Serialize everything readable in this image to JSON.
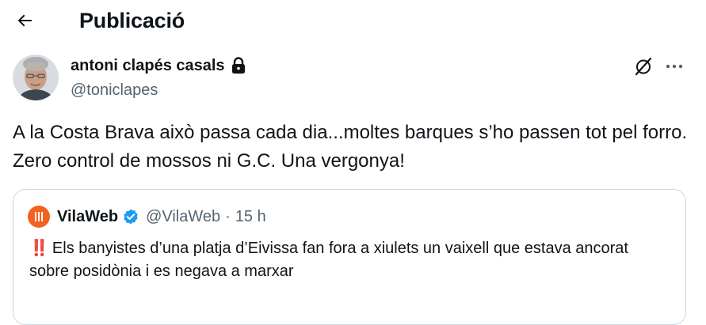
{
  "header": {
    "title": "Publicació",
    "back_icon": "arrow-left-icon"
  },
  "tweet": {
    "author_name": "antoni clapés casals",
    "author_handle": "@toniclapes",
    "protected_icon": "lock-icon",
    "grok_icon": "grok-icon",
    "more_icon": "more-horizontal-icon",
    "text": "A la Costa Brava això passa cada dia...moltes barques s’ho passen tot pel forro. Zero control de mossos ni G.C. Una vergonya!"
  },
  "quote": {
    "name": "VilaWeb",
    "handle": "@VilaWeb",
    "separator": "·",
    "time": "15 h",
    "verified_icon": "verified-badge-icon",
    "emoji": "‼️",
    "text": "Els banyistes d’una platja d’Eivissa fan fora a xiulets un vaixell que estava ancorat sobre posidònia i es negava a marxar"
  },
  "colors": {
    "text_primary": "#0f1419",
    "text_secondary": "#536471",
    "border": "#cfd9de",
    "verified_blue": "#1d9bf0",
    "vilaweb_orange": "#f4621f"
  }
}
